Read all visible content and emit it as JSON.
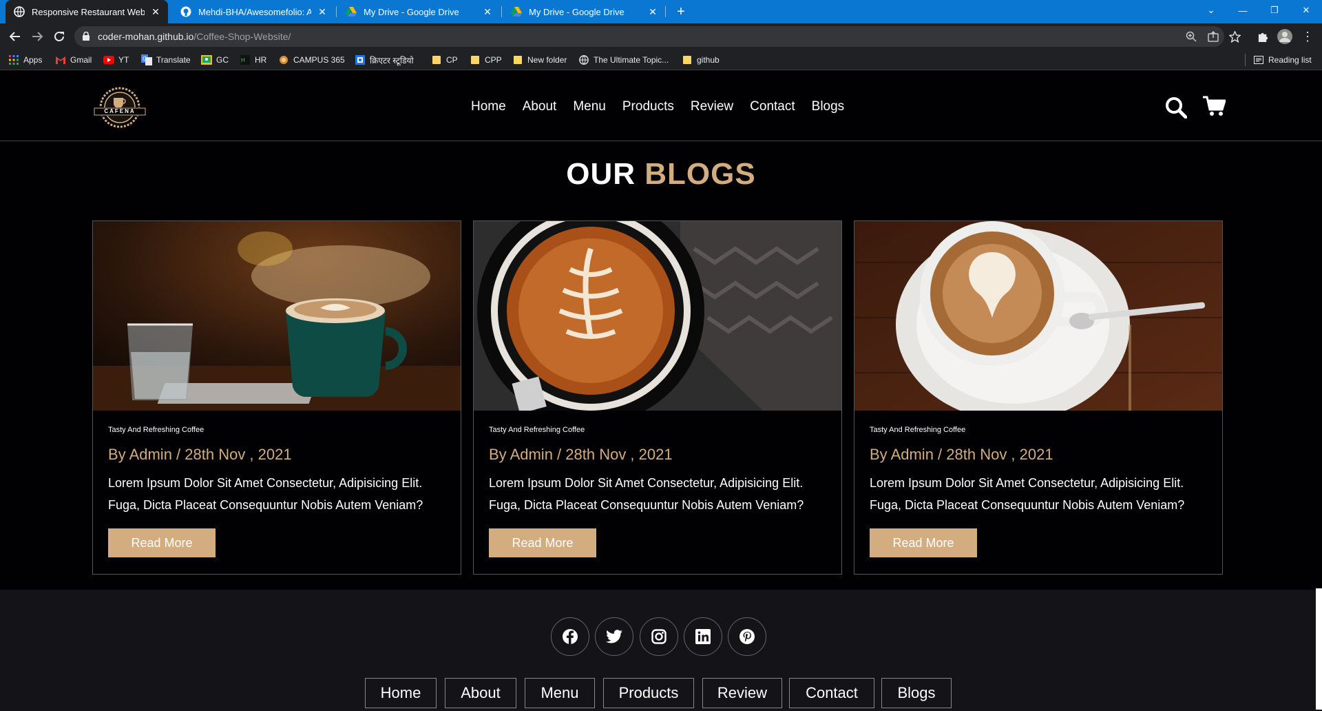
{
  "browser": {
    "tabs": [
      {
        "title": "Responsive Restaurant Website",
        "active": true
      },
      {
        "title": "Mehdi-BHA/Awesomefolio: A mo",
        "active": false
      },
      {
        "title": "My Drive - Google Drive",
        "active": false
      },
      {
        "title": "My Drive - Google Drive",
        "active": false
      }
    ],
    "url_host": "coder-mohan.github.io",
    "url_path": "/Coffee-Shop-Website/",
    "bookmarks": [
      {
        "label": "Apps",
        "icon": "apps-grid-icon"
      },
      {
        "label": "Gmail",
        "icon": "gmail-icon"
      },
      {
        "label": "YT",
        "icon": "youtube-icon"
      },
      {
        "label": "Translate",
        "icon": "translate-icon"
      },
      {
        "label": "GC",
        "icon": "classroom-icon"
      },
      {
        "label": "HR",
        "icon": "hackerrank-icon"
      },
      {
        "label": "CAMPUS 365",
        "icon": "campus-icon"
      },
      {
        "label": "क्रिएटर स्टूडियो",
        "icon": "studio-icon"
      },
      {
        "label": "CP",
        "icon": "folder-icon"
      },
      {
        "label": "CPP",
        "icon": "folder-icon"
      },
      {
        "label": "New folder",
        "icon": "folder-icon"
      },
      {
        "label": "The Ultimate Topic...",
        "icon": "globe-icon"
      },
      {
        "label": "github",
        "icon": "folder-icon"
      }
    ],
    "reading_list": "Reading list"
  },
  "site": {
    "logo_text": "CAFENA",
    "nav": [
      "Home",
      "About",
      "Menu",
      "Products",
      "Review",
      "Contact",
      "Blogs"
    ],
    "heading_white": "OUR",
    "heading_accent": "BLOGS",
    "accent_color": "#d3ad7f",
    "cards": [
      {
        "tag": "Tasty And Refreshing Coffee",
        "meta": "By Admin / 28th Nov , 2021",
        "line1": "Lorem Ipsum Dolor Sit Amet Consectetur, Adipisicing Elit.",
        "line2": "Fuga, Dicta Placeat Consequuntur Nobis Autem Veniam?",
        "button": "Read More"
      },
      {
        "tag": "Tasty And Refreshing Coffee",
        "meta": "By Admin / 28th Nov , 2021",
        "line1": "Lorem Ipsum Dolor Sit Amet Consectetur, Adipisicing Elit.",
        "line2": "Fuga, Dicta Placeat Consequuntur Nobis Autem Veniam?",
        "button": "Read More"
      },
      {
        "tag": "Tasty And Refreshing Coffee",
        "meta": "By Admin / 28th Nov , 2021",
        "line1": "Lorem Ipsum Dolor Sit Amet Consectetur, Adipisicing Elit.",
        "line2": "Fuga, Dicta Placeat Consequuntur Nobis Autem Veniam?",
        "button": "Read More"
      }
    ],
    "social": [
      "facebook-icon",
      "twitter-icon",
      "instagram-icon",
      "linkedin-icon",
      "pinterest-icon"
    ],
    "footer_links": [
      "Home",
      "About",
      "Menu",
      "Products",
      "Review",
      "Contact",
      "Blogs"
    ]
  }
}
